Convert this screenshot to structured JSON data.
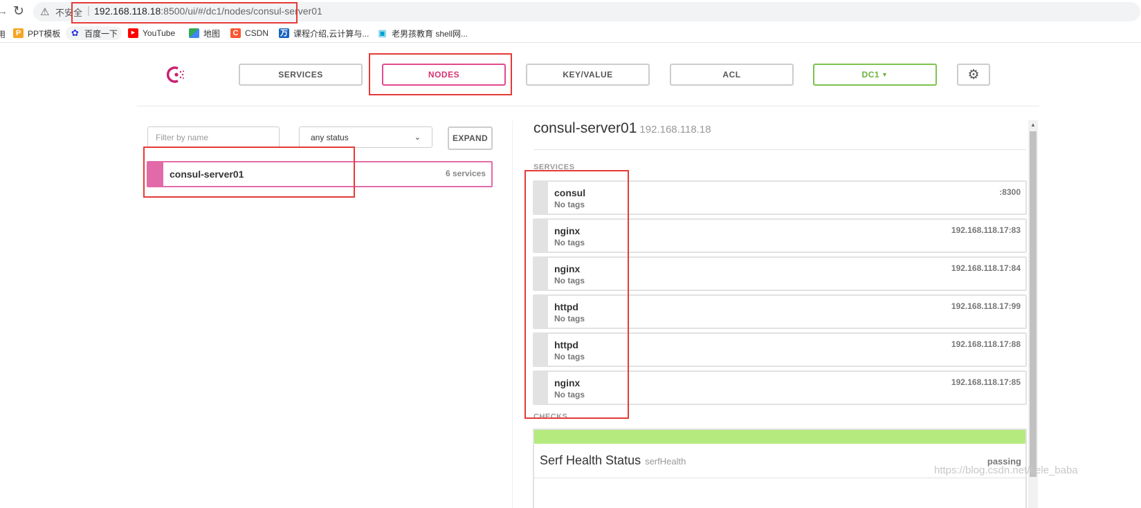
{
  "browser": {
    "insecure_label": "不安全",
    "url_host": "192.168.118.18",
    "url_path": ":8500/ui/#/dc1/nodes/consul-server01",
    "bookmarks": [
      {
        "label": "PPT模板",
        "icon": "ppt-icon",
        "color": "#f5a623"
      },
      {
        "label": "百度一下",
        "icon": "baidu-paw-icon",
        "color": "#2932e1"
      },
      {
        "label": "YouTube",
        "icon": "youtube-icon",
        "color": "#ff0000"
      },
      {
        "label": "地图",
        "icon": "maps-pin-icon",
        "color": "#34a853"
      },
      {
        "label": "CSDN",
        "icon": "csdn-icon",
        "color": "#fc5531"
      },
      {
        "label": "课程介绍,云计算与...",
        "icon": "wan-icon",
        "color": "#1565c0"
      },
      {
        "label": "老男孩教育 shell网...",
        "icon": "bilibili-tv-icon",
        "color": "#00a1d6"
      }
    ]
  },
  "nav": {
    "services": "SERVICES",
    "nodes": "NODES",
    "key_value": "KEY/VALUE",
    "acl": "ACL",
    "datacenter": "DC1",
    "accent_color": "#e14a8e",
    "dc_color": "#7cc24b"
  },
  "filter": {
    "placeholder": "Filter by name",
    "status_value": "any status",
    "expand_label": "EXPAND"
  },
  "nodes_list": [
    {
      "name": "consul-server01",
      "services_count": "6 services"
    }
  ],
  "detail": {
    "node_name": "consul-server01",
    "node_ip": "192.168.118.18",
    "services_heading": "SERVICES",
    "checks_heading": "CHECKS",
    "services": [
      {
        "name": "consul",
        "tags": "No tags",
        "address": ":8300"
      },
      {
        "name": "nginx",
        "tags": "No tags",
        "address": "192.168.118.17:83"
      },
      {
        "name": "nginx",
        "tags": "No tags",
        "address": "192.168.118.17:84"
      },
      {
        "name": "httpd",
        "tags": "No tags",
        "address": "192.168.118.17:99"
      },
      {
        "name": "httpd",
        "tags": "No tags",
        "address": "192.168.118.17:88"
      },
      {
        "name": "nginx",
        "tags": "No tags",
        "address": "192.168.118.17:85"
      }
    ],
    "checks": [
      {
        "name": "Serf Health Status",
        "id": "serfHealth",
        "status": "passing",
        "status_color": "#b5ea7e"
      }
    ]
  },
  "watermark": "https://blog.csdn.net/kele_baba"
}
